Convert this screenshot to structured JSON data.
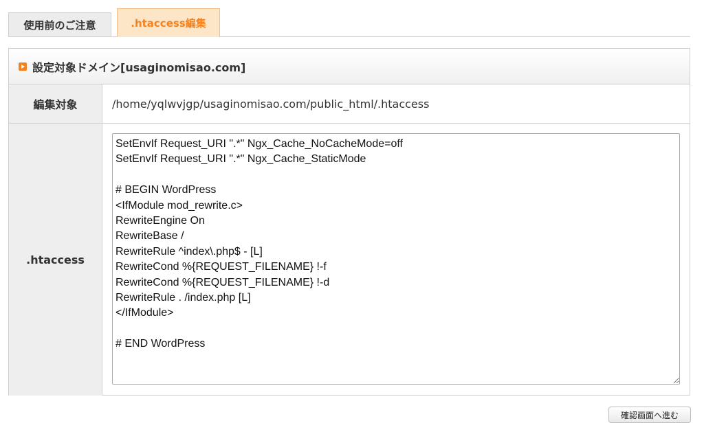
{
  "tabs": [
    {
      "label": "使用前のご注意"
    },
    {
      "label": ".htaccess編集"
    }
  ],
  "panel": {
    "title": "設定対象ドメイン[usaginomisao.com]",
    "rows": {
      "target_label": "編集対象",
      "target_value": "/home/yqlwvjgp/usaginomisao.com/public_html/.htaccess",
      "htaccess_label": ".htaccess",
      "htaccess_content": "SetEnvIf Request_URI \".*\" Ngx_Cache_NoCacheMode=off\nSetEnvIf Request_URI \".*\" Ngx_Cache_StaticMode\n\n# BEGIN WordPress\n<IfModule mod_rewrite.c>\nRewriteEngine On\nRewriteBase /\nRewriteRule ^index\\.php$ - [L]\nRewriteCond %{REQUEST_FILENAME} !-f\nRewriteCond %{REQUEST_FILENAME} !-d\nRewriteRule . /index.php [L]\n</IfModule>\n\n# END WordPress"
    }
  },
  "confirm_button": {
    "label": "確認画面へ進む"
  },
  "colors": {
    "accent": "#f5821f",
    "active_tab_bg": "#fde6c8",
    "label_bg": "#eeeeee"
  }
}
